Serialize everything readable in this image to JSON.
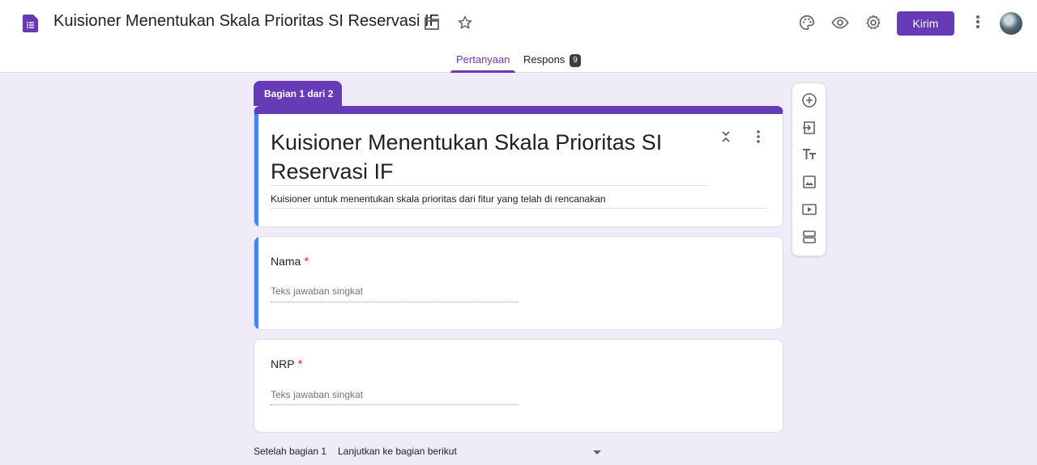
{
  "header": {
    "doc_title": "Kuisioner Menentukan Skala Prioritas SI Reservasi IF",
    "send_label": "Kirim",
    "accent_color": "#673ab7"
  },
  "tabs": {
    "questions": "Pertanyaan",
    "responses": "Respons",
    "responses_count": "9"
  },
  "section": {
    "tab_label": "Bagian 1 dari 2",
    "title": "Kuisioner Menentukan Skala Prioritas SI Reservasi IF",
    "description": "Kuisioner untuk menentukan skala prioritas dari fitur yang telah di rencanakan"
  },
  "questions": [
    {
      "label": "Nama",
      "required_mark": "*",
      "placeholder": "Teks jawaban singkat"
    },
    {
      "label": "NRP",
      "required_mark": "*",
      "placeholder": "Teks jawaban singkat"
    }
  ],
  "footer": {
    "after_section_label": "Setelah bagian 1",
    "after_section_value": "Lanjutkan ke bagian berikut"
  },
  "icons": {
    "logo": "google-forms-logo",
    "toolbar": [
      "add-question-icon",
      "import-questions-icon",
      "add-title-icon",
      "add-image-icon",
      "add-video-icon",
      "add-section-icon"
    ]
  }
}
